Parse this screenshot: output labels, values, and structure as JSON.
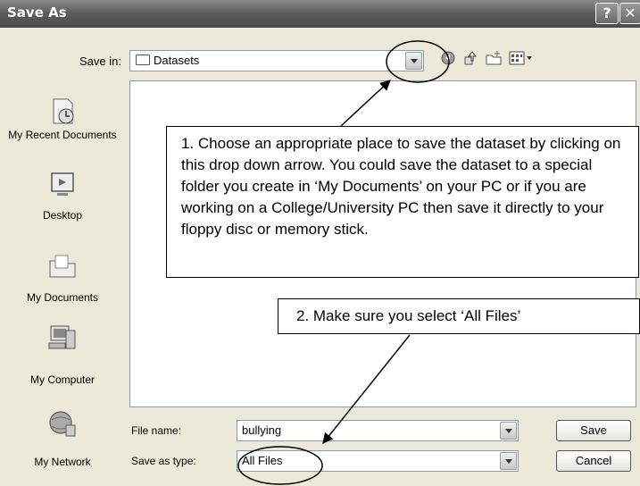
{
  "window": {
    "title": "Save As",
    "help_glyph": "?",
    "close_glyph": "✕"
  },
  "toolbar": {
    "save_in_label": "Save in:",
    "save_in_value": "Datasets",
    "icons": [
      "back-icon",
      "up-folder-icon",
      "new-folder-icon",
      "views-menu-icon"
    ]
  },
  "places": [
    {
      "label": "My Recent Documents",
      "icon": "recent-documents-icon"
    },
    {
      "label": "Desktop",
      "icon": "desktop-icon"
    },
    {
      "label": "My Documents",
      "icon": "my-documents-icon"
    },
    {
      "label": "My Computer",
      "icon": "my-computer-icon"
    },
    {
      "label": "My Network",
      "icon": "my-network-icon"
    }
  ],
  "form": {
    "file_name_label": "File name:",
    "file_name_value": "bullying",
    "save_type_label": "Save as type:",
    "save_type_value": "All Files"
  },
  "buttons": {
    "save": "Save",
    "cancel": "Cancel"
  },
  "annotations": {
    "callout1": "1. Choose an appropriate place to save the dataset by clicking on this drop down arrow. You could save the dataset to a special folder you create in ‘My Documents’ on your PC or if you are working on a College/University PC then save it directly to your floppy disc or memory stick.",
    "callout2": "2. Make sure you select ‘All Files’"
  }
}
